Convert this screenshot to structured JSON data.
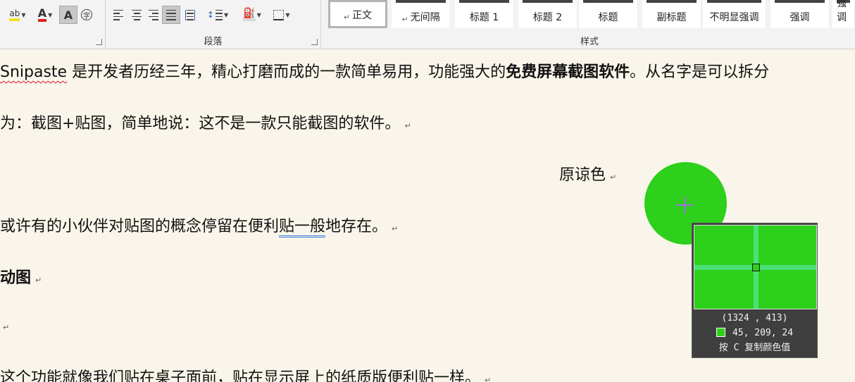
{
  "ribbon": {
    "font_group": {
      "buttons": [
        {
          "name": "text-highlight-color",
          "glyph": "ab"
        },
        {
          "name": "font-color",
          "glyph": "A"
        },
        {
          "name": "character-shading",
          "glyph": "A"
        },
        {
          "name": "enclose-characters",
          "glyph": "字"
        }
      ],
      "highlight_color": "#f3e21b",
      "font_color": "#e02020"
    },
    "paragraph_group": {
      "label": "段落"
    },
    "styles_group": {
      "label": "样式",
      "tiles": [
        "正文",
        "无间隔",
        "标题 1",
        "标题 2",
        "标题",
        "副标题",
        "不明显强调",
        "强调",
        "明显强调"
      ]
    }
  },
  "document": {
    "para1": {
      "brand": "Snipaste",
      "text_a": " 是开发者历经三年，精心打磨而成的一款简单易用，功能强大的",
      "bold": "免费屏幕截图软件",
      "text_b": "。从名字是可以拆分"
    },
    "para2": "为：截图+贴图，简单地说：这不是一款只能截图的软件。",
    "para3": "原谅色",
    "para4": {
      "text_a": "或许有的小伙伴对贴图的概念停留在便利",
      "underlined": "贴一般",
      "text_b": "地存在。"
    },
    "heading": "动图",
    "para5": "这个功能就像我们贴在桌子面前，贴在显示屏上的纸质版便利贴一样。",
    "paragraph_mark": "↵"
  },
  "picker": {
    "coords": "(1324 , 413)",
    "rgb": "45, 209,  24",
    "hint": "按 C 复制颜色值",
    "color": "#2dd118"
  }
}
